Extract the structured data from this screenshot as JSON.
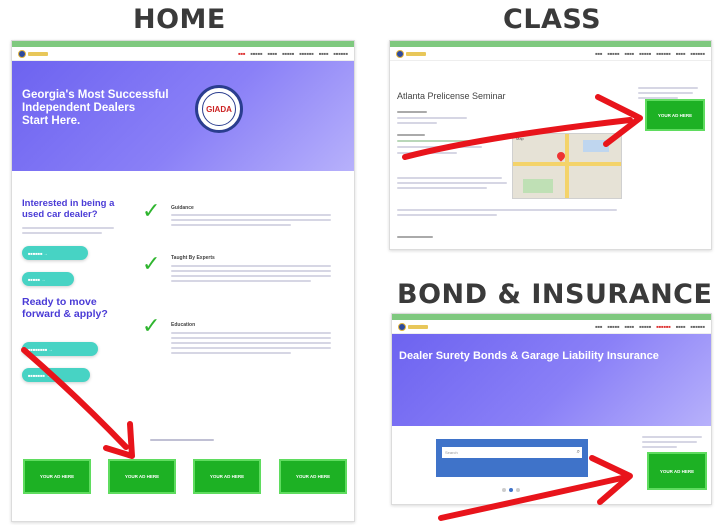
{
  "headings": {
    "home": "HOME",
    "class": "CLASS",
    "bond": "BOND & INSURANCE"
  },
  "colors": {
    "nav_green": "#7fc97f",
    "hero_purple": "#6d63f0",
    "cta_green": "#1db124",
    "teal": "#47d3c4",
    "arrow_red": "#e8141b",
    "check_green": "#2fb52f"
  },
  "home": {
    "hero_title_lines": [
      "Georgia's Most Successful",
      "Independent Dealers",
      "Start Here."
    ],
    "badge_text": "GIADA",
    "left_headline": "Interested in being a used car dealer?",
    "left_headline2": "Ready to move forward & apply?",
    "features": [
      {
        "title": "Guidance"
      },
      {
        "title": "Taught By Experts"
      },
      {
        "title": "Education"
      }
    ],
    "button_label": "YOUR AD HERE",
    "icons": [
      "check-icon",
      "right-arrow-icon"
    ]
  },
  "class": {
    "page_title": "Atlanta Prelicense Seminar",
    "map_label": "Map",
    "button_label": "YOUR AD HERE"
  },
  "bond": {
    "hero_title": "Dealer Surety Bonds & Garage Liability Insurance",
    "search_placeholder": "Search",
    "button_label": "YOUR AD HERE"
  }
}
